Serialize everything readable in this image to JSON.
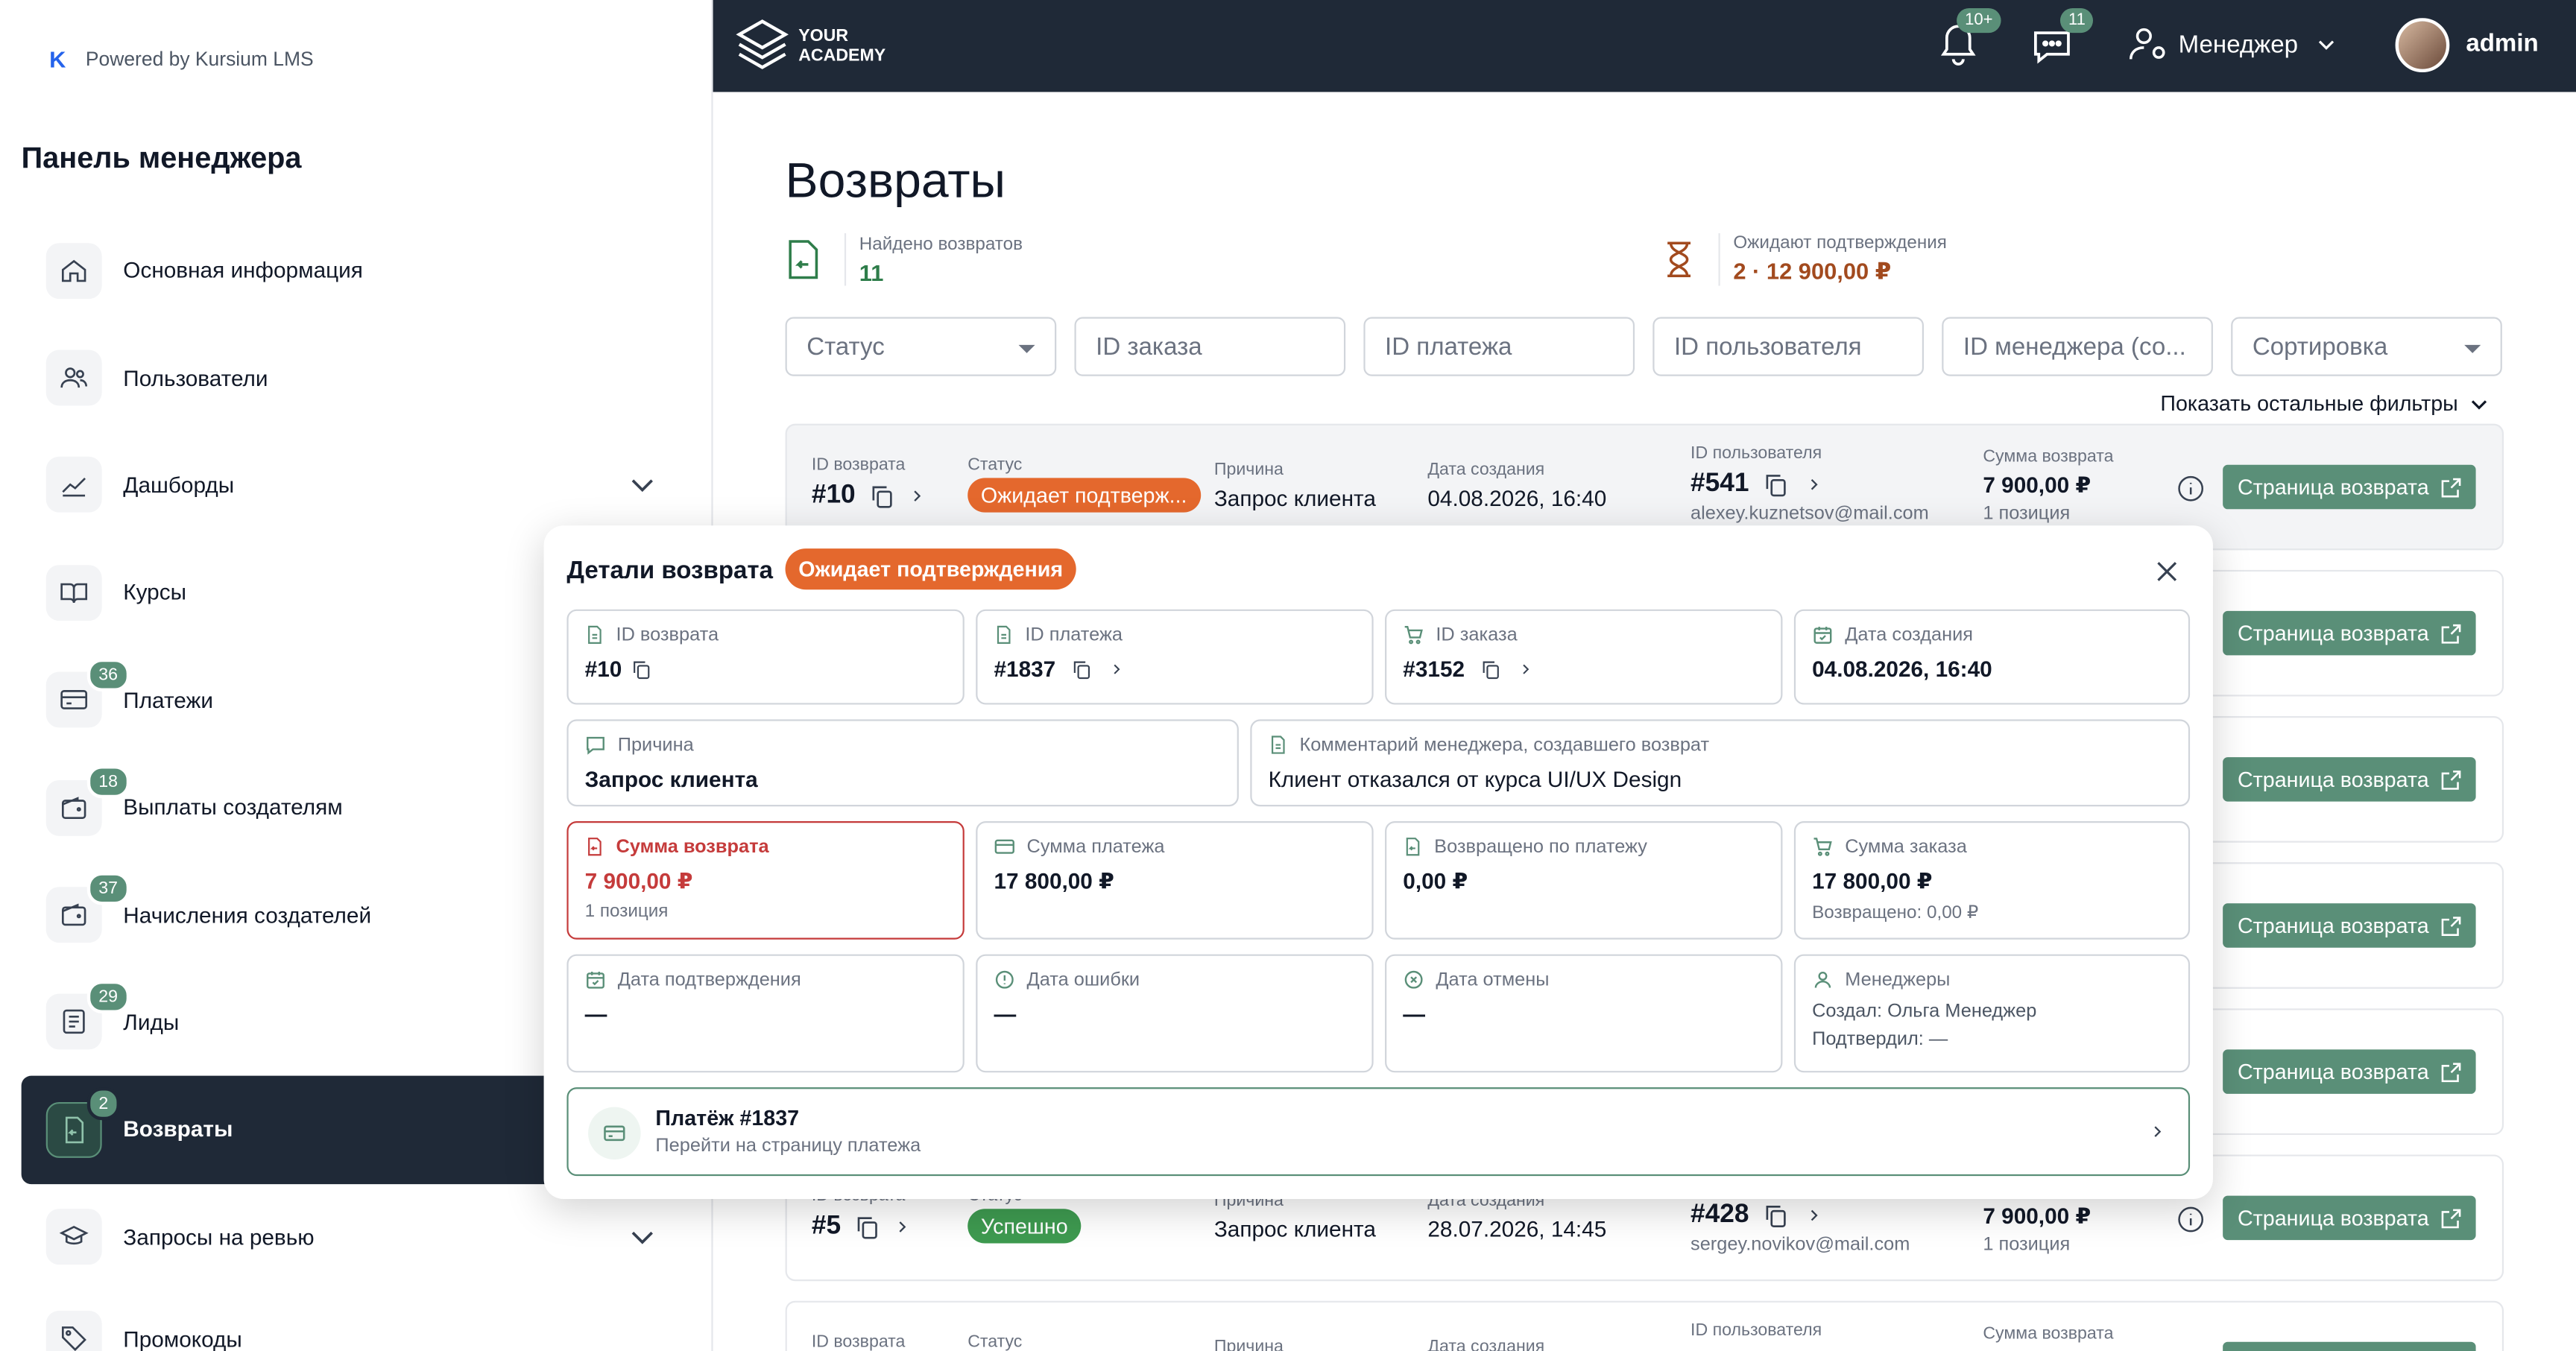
{
  "sidebar": {
    "powered": "Powered by Kursium LMS",
    "title": "Панель менеджера",
    "items": [
      {
        "label": "Основная информация",
        "icon": "home-icon",
        "badge": ""
      },
      {
        "label": "Пользователи",
        "icon": "users-icon",
        "badge": ""
      },
      {
        "label": "Дашборды",
        "icon": "chart-icon",
        "badge": ""
      },
      {
        "label": "Курсы",
        "icon": "book-icon",
        "badge": ""
      },
      {
        "label": "Платежи",
        "icon": "card-icon",
        "badge": "36"
      },
      {
        "label": "Выплаты создателям",
        "icon": "wallet-icon",
        "badge": "18"
      },
      {
        "label": "Начисления создателей",
        "icon": "wallet-icon",
        "badge": "37"
      },
      {
        "label": "Лиды",
        "icon": "list-icon",
        "badge": "29"
      },
      {
        "label": "Возвраты",
        "icon": "refund-doc-icon",
        "badge": "2"
      },
      {
        "label": "Запросы на ревью",
        "icon": "graduation-cap-icon",
        "badge": ""
      },
      {
        "label": "Промокоды",
        "icon": "tag-icon",
        "badge": ""
      }
    ]
  },
  "topbar": {
    "logo_line1": "YOUR",
    "logo_line2": "ACADEMY",
    "notifications_badge": "10+",
    "messages_badge": "11",
    "role": "Менеджер",
    "user": "admin"
  },
  "page": {
    "title": "Возвраты",
    "found_label": "Найдено возвратов",
    "found_value": "11",
    "pending_label": "Ожидают подтверждения",
    "pending_value": "2 · 12 900,00 ₽",
    "show_filters": "Показать остальные фильтры"
  },
  "filters": [
    {
      "placeholder": "Статус",
      "dropdown": true
    },
    {
      "placeholder": "ID заказа",
      "dropdown": false
    },
    {
      "placeholder": "ID платежа",
      "dropdown": false
    },
    {
      "placeholder": "ID пользователя",
      "dropdown": false
    },
    {
      "placeholder": "ID менеджера (со...",
      "dropdown": false
    },
    {
      "placeholder": "Сортировка",
      "dropdown": true
    }
  ],
  "table": {
    "labels": {
      "refund_id": "ID возврата",
      "status": "Статус",
      "reason": "Причина",
      "created": "Дата создания",
      "user_id": "ID пользователя",
      "amount": "Сумма возврата",
      "button": "Страница возврата"
    },
    "rows": [
      {
        "id": "#10",
        "status": "Ожидает подтверж...",
        "reason": "Запрос клиента",
        "created": "04.08.2026, 16:40",
        "user": "#541",
        "email": "alexey.kuznetsov@mail.com",
        "amount": "7 900,00 ₽",
        "positions": "1 позиция"
      },
      {
        "id": "#5",
        "status": "Успешно",
        "reason": "Запрос клиента",
        "created": "28.07.2026, 14:45",
        "user": "#428",
        "email": "sergey.novikov@mail.com",
        "amount": "7 900,00 ₽",
        "positions": "1 позиция"
      }
    ]
  },
  "modal": {
    "title": "Детали возврата",
    "status": "Ожидает подтверждения",
    "refund_id_label": "ID возврата",
    "refund_id": "#10",
    "payment_id_label": "ID платежа",
    "payment_id": "#1837",
    "order_id_label": "ID заказа",
    "order_id": "#3152",
    "created_label": "Дата создания",
    "created": "04.08.2026, 16:40",
    "reason_label": "Причина",
    "reason": "Запрос клиента",
    "comment_label": "Комментарий менеджера, создавшего возврат",
    "comment": "Клиент отказался от курса UI/UX Design",
    "refund_amount_label": "Сумма возврата",
    "refund_amount": "7 900,00 ₽",
    "refund_positions": "1 позиция",
    "payment_amount_label": "Сумма платежа",
    "payment_amount": "17 800,00 ₽",
    "returned_label": "Возвращено по платежу",
    "returned": "0,00 ₽",
    "order_amount_label": "Сумма заказа",
    "order_amount": "17 800,00 ₽",
    "order_returned": "Возвращено: 0,00 ₽",
    "confirmed_label": "Дата подтверждения",
    "confirmed": "—",
    "error_label": "Дата ошибки",
    "error": "—",
    "cancel_label": "Дата отмены",
    "cancel": "—",
    "managers_label": "Менеджеры",
    "created_by": "Создал: Ольга Менеджер",
    "confirmed_by": "Подтвердил: —",
    "payment_link_title": "Платёж #1837",
    "payment_link_sub": "Перейти на страницу платежа"
  },
  "colors": {
    "accent": "#5a8f78",
    "dark": "#1f2937",
    "orange": "#e4682d",
    "green": "#3e9a50",
    "red": "#c53b3b"
  }
}
